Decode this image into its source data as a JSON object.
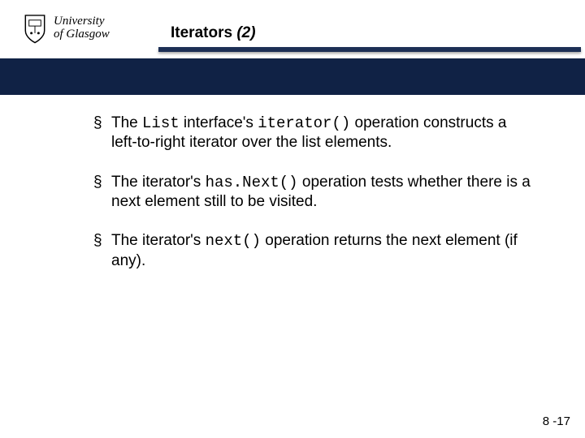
{
  "logo": {
    "line1": "University",
    "line2": "of Glasgow"
  },
  "title": {
    "main": "Iterators",
    "suffix": "(2)"
  },
  "bullets": [
    {
      "pre": "The ",
      "code1": "List",
      "mid1": " interface's ",
      "code2": "iterator()",
      "post": " operation constructs a left-to-right iterator over the list elements."
    },
    {
      "pre": "The iterator's ",
      "code1": "has.Next()",
      "mid1": "",
      "code2": "",
      "post": " operation tests whether there is a next element still to be visited."
    },
    {
      "pre": "The iterator's ",
      "code1": "next()",
      "mid1": "",
      "code2": "",
      "post": " operation returns the next element (if any)."
    }
  ],
  "pagenum": "8 -17"
}
